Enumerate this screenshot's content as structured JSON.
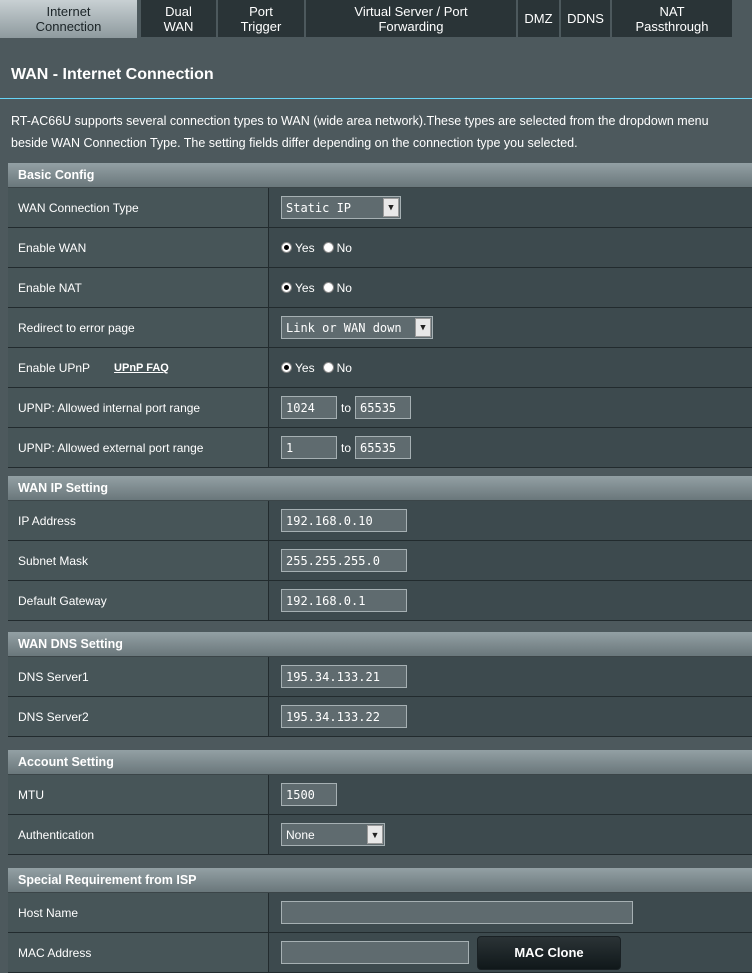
{
  "tabs": [
    {
      "label": "Internet\nConnection",
      "active": true
    },
    {
      "label": "Dual\nWAN"
    },
    {
      "label": "Port\nTrigger"
    },
    {
      "label": "Virtual Server / Port\nForwarding"
    },
    {
      "label": "DMZ"
    },
    {
      "label": "DDNS"
    },
    {
      "label": "NAT\nPassthrough"
    }
  ],
  "page": {
    "title": "WAN - Internet Connection",
    "description": "RT-AC66U supports several connection types to WAN (wide area network).These types are selected from the dropdown menu beside WAN Connection Type. The setting fields differ depending on the connection type you selected."
  },
  "basic": {
    "header": "Basic Config",
    "wan_type_label": "WAN Connection Type",
    "wan_type_value": "Static IP",
    "enable_wan_label": "Enable WAN",
    "enable_nat_label": "Enable NAT",
    "redirect_label": "Redirect to error page",
    "redirect_value": "Link or WAN down",
    "upnp_label": "Enable UPnP",
    "upnp_faq": "UPnP  FAQ",
    "int_range_label": "UPNP: Allowed internal port range",
    "int_from": "1024",
    "int_to": "65535",
    "ext_range_label": "UPNP: Allowed external port range",
    "ext_from": "1",
    "ext_to": "65535",
    "yes": "Yes",
    "no": "No",
    "to": "to"
  },
  "wanip": {
    "header": "WAN IP Setting",
    "ip_label": "IP Address",
    "ip_value": "192.168.0.10",
    "mask_label": "Subnet Mask",
    "mask_value": "255.255.255.0",
    "gw_label": "Default Gateway",
    "gw_value": "192.168.0.1"
  },
  "dns": {
    "header": "WAN DNS Setting",
    "dns1_label": "DNS Server1",
    "dns1_value": "195.34.133.21",
    "dns2_label": "DNS Server2",
    "dns2_value": "195.34.133.22"
  },
  "account": {
    "header": "Account Setting",
    "mtu_label": "MTU",
    "mtu_value": "1500",
    "auth_label": "Authentication",
    "auth_value": "None"
  },
  "isp": {
    "header": "Special Requirement from ISP",
    "host_label": "Host Name",
    "host_value": "",
    "mac_label": "MAC Address",
    "mac_value": "",
    "mac_clone": "MAC Clone"
  }
}
